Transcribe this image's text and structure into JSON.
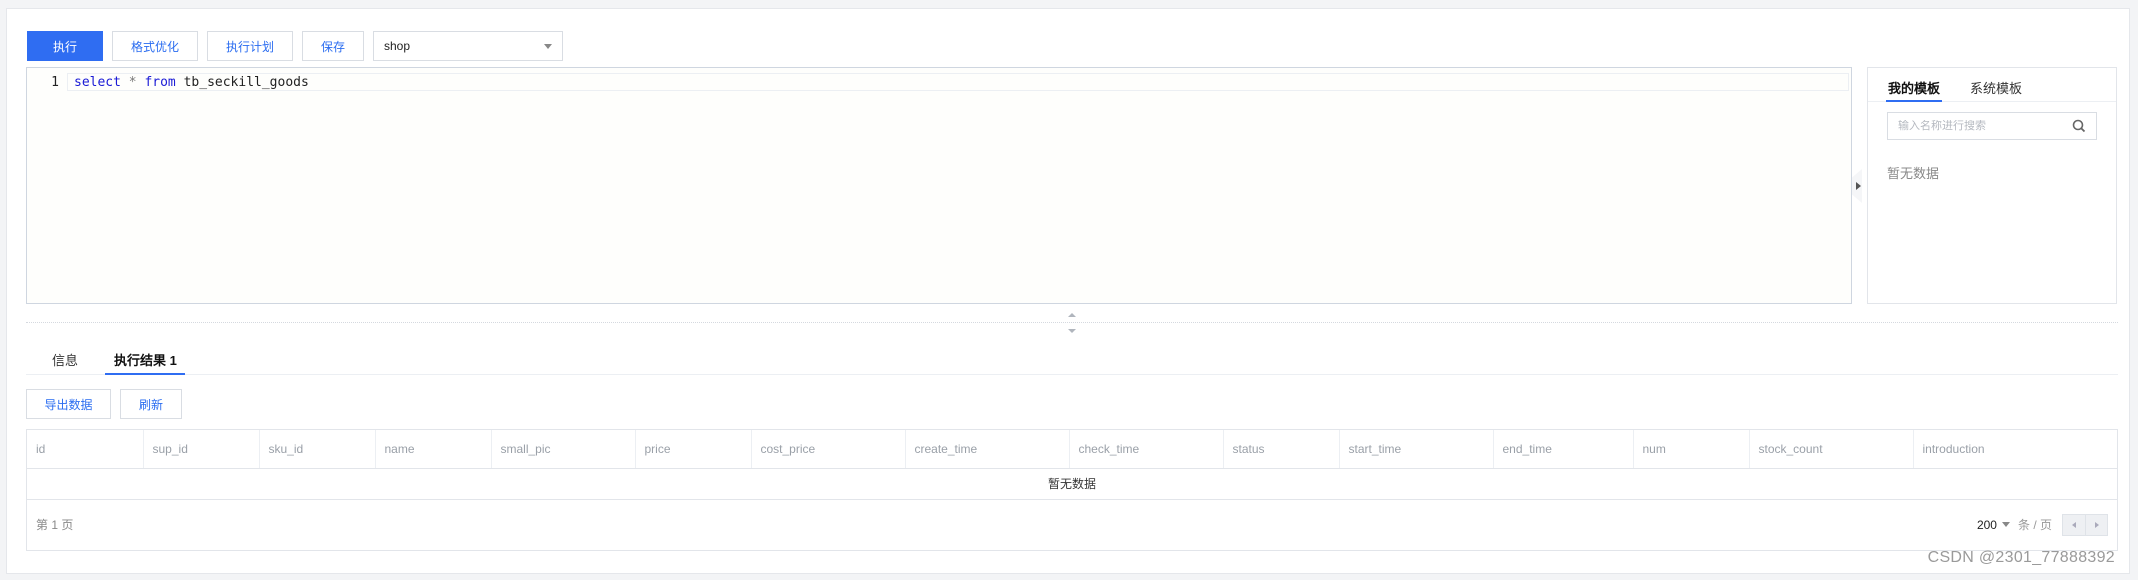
{
  "toolbar": {
    "execute_label": "执行",
    "format_label": "格式优化",
    "explain_label": "执行计划",
    "save_label": "保存",
    "database_selected": "shop"
  },
  "editor": {
    "line_number": "1",
    "code_tokens": [
      {
        "type": "keyword",
        "text": "select"
      },
      {
        "type": "operator",
        "text": "*"
      },
      {
        "type": "keyword",
        "text": "from"
      },
      {
        "type": "identifier",
        "text": "tb_seckill_goods"
      }
    ]
  },
  "templates": {
    "tabs": [
      {
        "label": "我的模板",
        "active": true
      },
      {
        "label": "系统模板",
        "active": false
      }
    ],
    "search_placeholder": "输入名称进行搜索",
    "empty_text": "暂无数据"
  },
  "results": {
    "tabs": [
      {
        "label": "信息",
        "active": false
      },
      {
        "label": "执行结果 1",
        "active": true
      }
    ],
    "export_label": "导出数据",
    "refresh_label": "刷新",
    "columns": [
      "id",
      "sup_id",
      "sku_id",
      "name",
      "small_pic",
      "price",
      "cost_price",
      "create_time",
      "check_time",
      "status",
      "start_time",
      "end_time",
      "num",
      "stock_count",
      "introduction"
    ],
    "empty_text": "暂无数据",
    "pagination": {
      "current_page_text": "第 1 页",
      "page_size": "200",
      "per_page_unit": "条 / 页"
    }
  },
  "watermark": "CSDN @2301_77888392",
  "colors": {
    "primary": "#2f6df2",
    "keyword": "#1a1ad6"
  }
}
